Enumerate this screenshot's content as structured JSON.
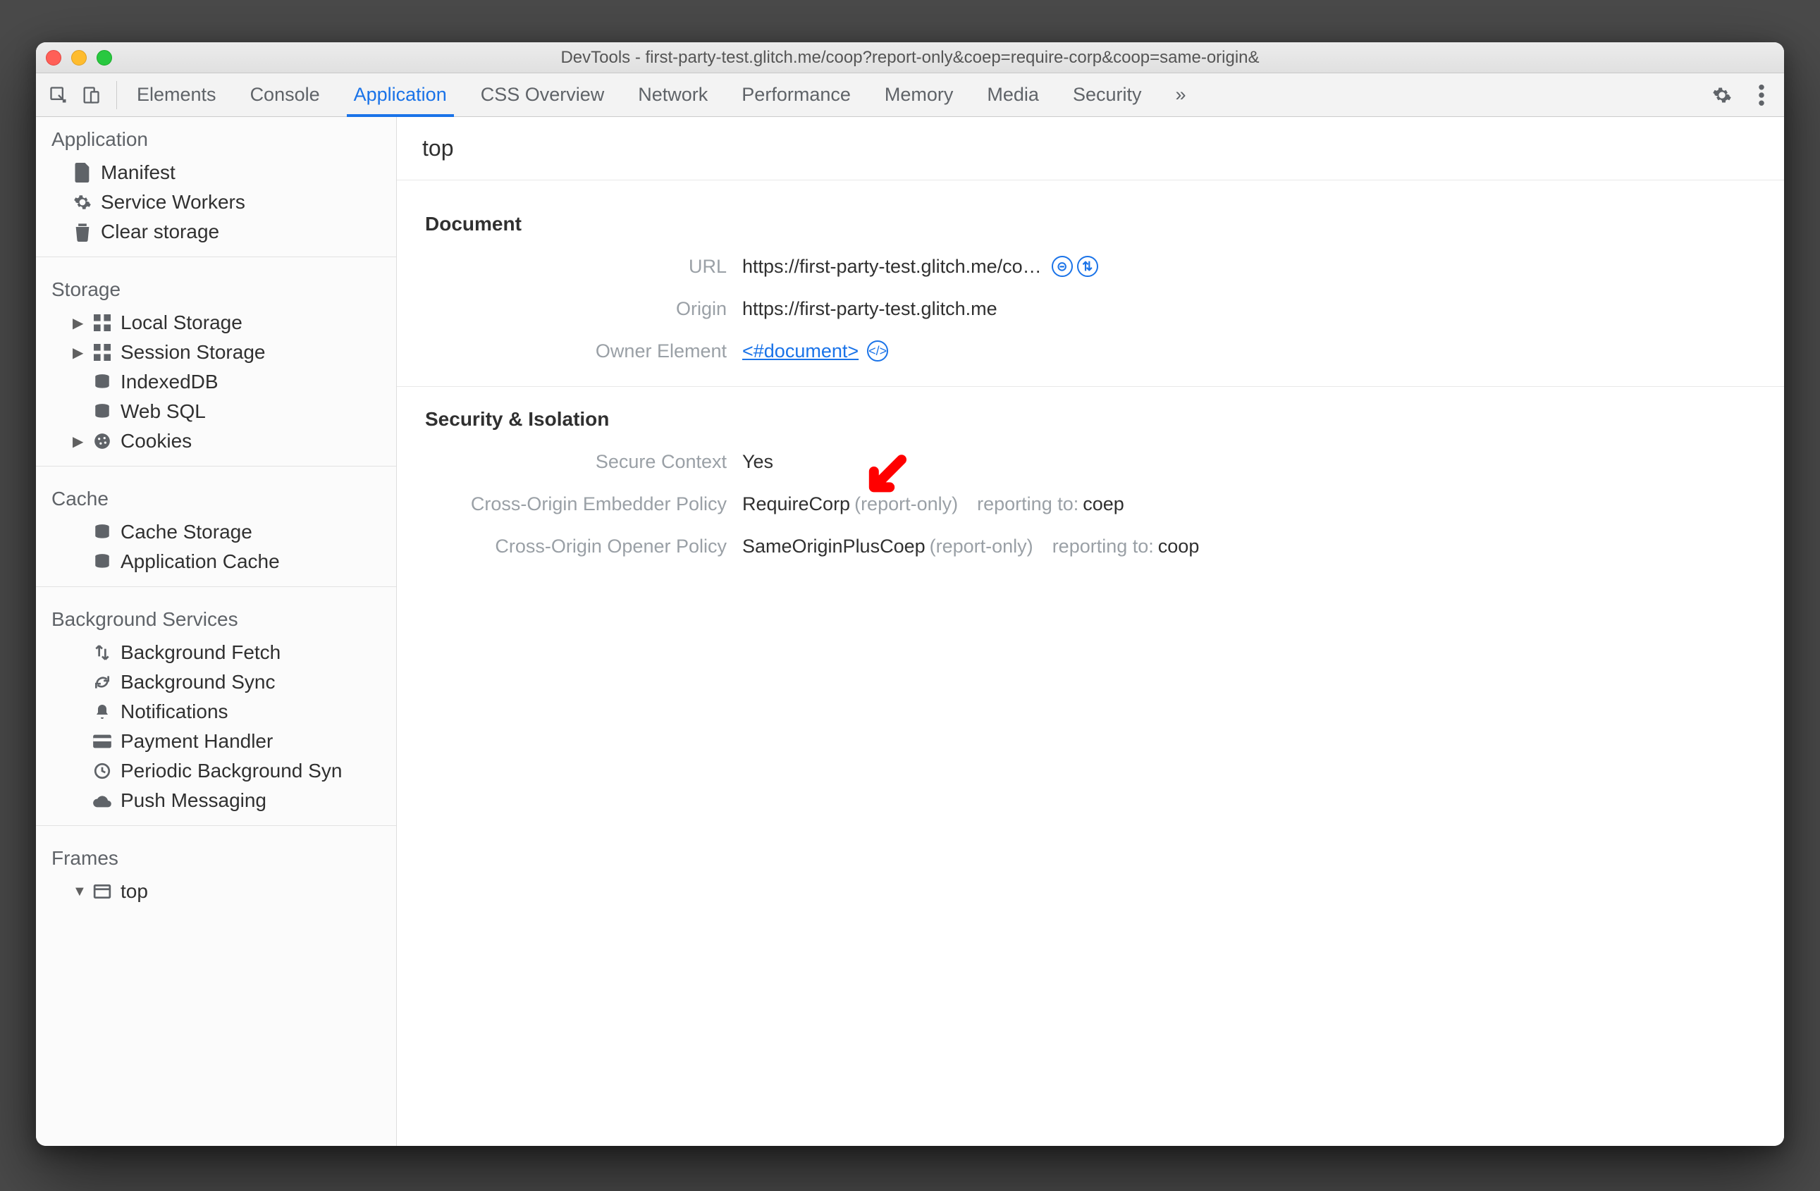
{
  "window": {
    "title": "DevTools - first-party-test.glitch.me/coop?report-only&coep=require-corp&coop=same-origin&"
  },
  "toolbar": {
    "tabs": [
      "Elements",
      "Console",
      "Application",
      "CSS Overview",
      "Network",
      "Performance",
      "Memory",
      "Media",
      "Security"
    ],
    "active_index": 2,
    "overflow": "»"
  },
  "sidebar": {
    "sections": [
      {
        "title": "Application",
        "items": [
          {
            "icon": "file-icon",
            "label": "Manifest"
          },
          {
            "icon": "gear-icon",
            "label": "Service Workers"
          },
          {
            "icon": "trash-icon",
            "label": "Clear storage"
          }
        ]
      },
      {
        "title": "Storage",
        "items": [
          {
            "icon": "grid-icon",
            "label": "Local Storage",
            "expandable": true
          },
          {
            "icon": "grid-icon",
            "label": "Session Storage",
            "expandable": true
          },
          {
            "icon": "database-icon",
            "label": "IndexedDB"
          },
          {
            "icon": "database-icon",
            "label": "Web SQL"
          },
          {
            "icon": "cookie-icon",
            "label": "Cookies",
            "expandable": true
          }
        ]
      },
      {
        "title": "Cache",
        "items": [
          {
            "icon": "database-icon",
            "label": "Cache Storage"
          },
          {
            "icon": "database-icon",
            "label": "Application Cache"
          }
        ]
      },
      {
        "title": "Background Services",
        "items": [
          {
            "icon": "arrows-icon",
            "label": "Background Fetch"
          },
          {
            "icon": "sync-icon",
            "label": "Background Sync"
          },
          {
            "icon": "bell-icon",
            "label": "Notifications"
          },
          {
            "icon": "card-icon",
            "label": "Payment Handler"
          },
          {
            "icon": "clock-icon",
            "label": "Periodic Background Syn"
          },
          {
            "icon": "cloud-icon",
            "label": "Push Messaging"
          }
        ]
      },
      {
        "title": "Frames",
        "items": [
          {
            "icon": "window-icon",
            "label": "top",
            "expandable": true,
            "open": true,
            "selected": true
          }
        ]
      }
    ]
  },
  "main": {
    "frame_title": "top",
    "document": {
      "heading": "Document",
      "url_label": "URL",
      "url_value": "https://first-party-test.glitch.me/co…",
      "origin_label": "Origin",
      "origin_value": "https://first-party-test.glitch.me",
      "owner_label": "Owner Element",
      "owner_value": "<#document>"
    },
    "security": {
      "heading": "Security & Isolation",
      "secure_context_label": "Secure Context",
      "secure_context_value": "Yes",
      "coep_label": "Cross-Origin Embedder Policy",
      "coep_value": "RequireCorp",
      "coep_mode": "(report-only)",
      "coep_report_label": "reporting to:",
      "coep_report_value": "coep",
      "coop_label": "Cross-Origin Opener Policy",
      "coop_value": "SameOriginPlusCoep",
      "coop_mode": "(report-only)",
      "coop_report_label": "reporting to:",
      "coop_report_value": "coop"
    }
  }
}
